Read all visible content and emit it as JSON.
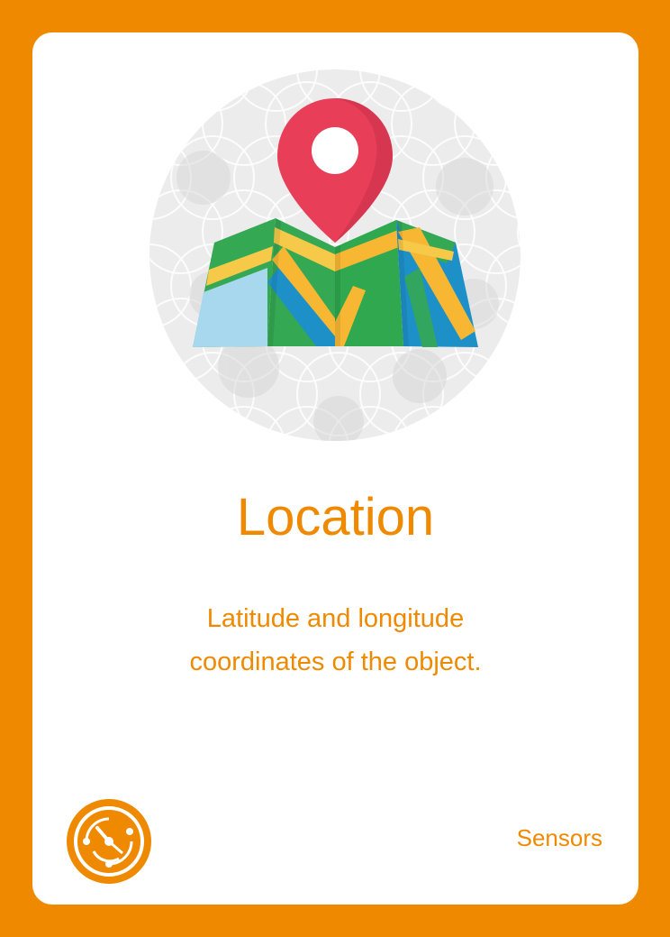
{
  "card": {
    "title": "Location",
    "description_line_1": "Latitude and longitude",
    "description_line_2": "coordinates of the object.",
    "category": "Sensors",
    "illustration_icon": "folded-map-with-location-pin",
    "category_icon": "sensor-radar-icon"
  },
  "colors": {
    "border": "#ef8a00",
    "card_background": "#ffffff",
    "text": "#ef8a00",
    "pin": "#e83e57",
    "map_green": "#34a853",
    "map_blue": "#1e90c8",
    "map_light_blue": "#a8d8ee",
    "map_road": "#f7b733"
  }
}
